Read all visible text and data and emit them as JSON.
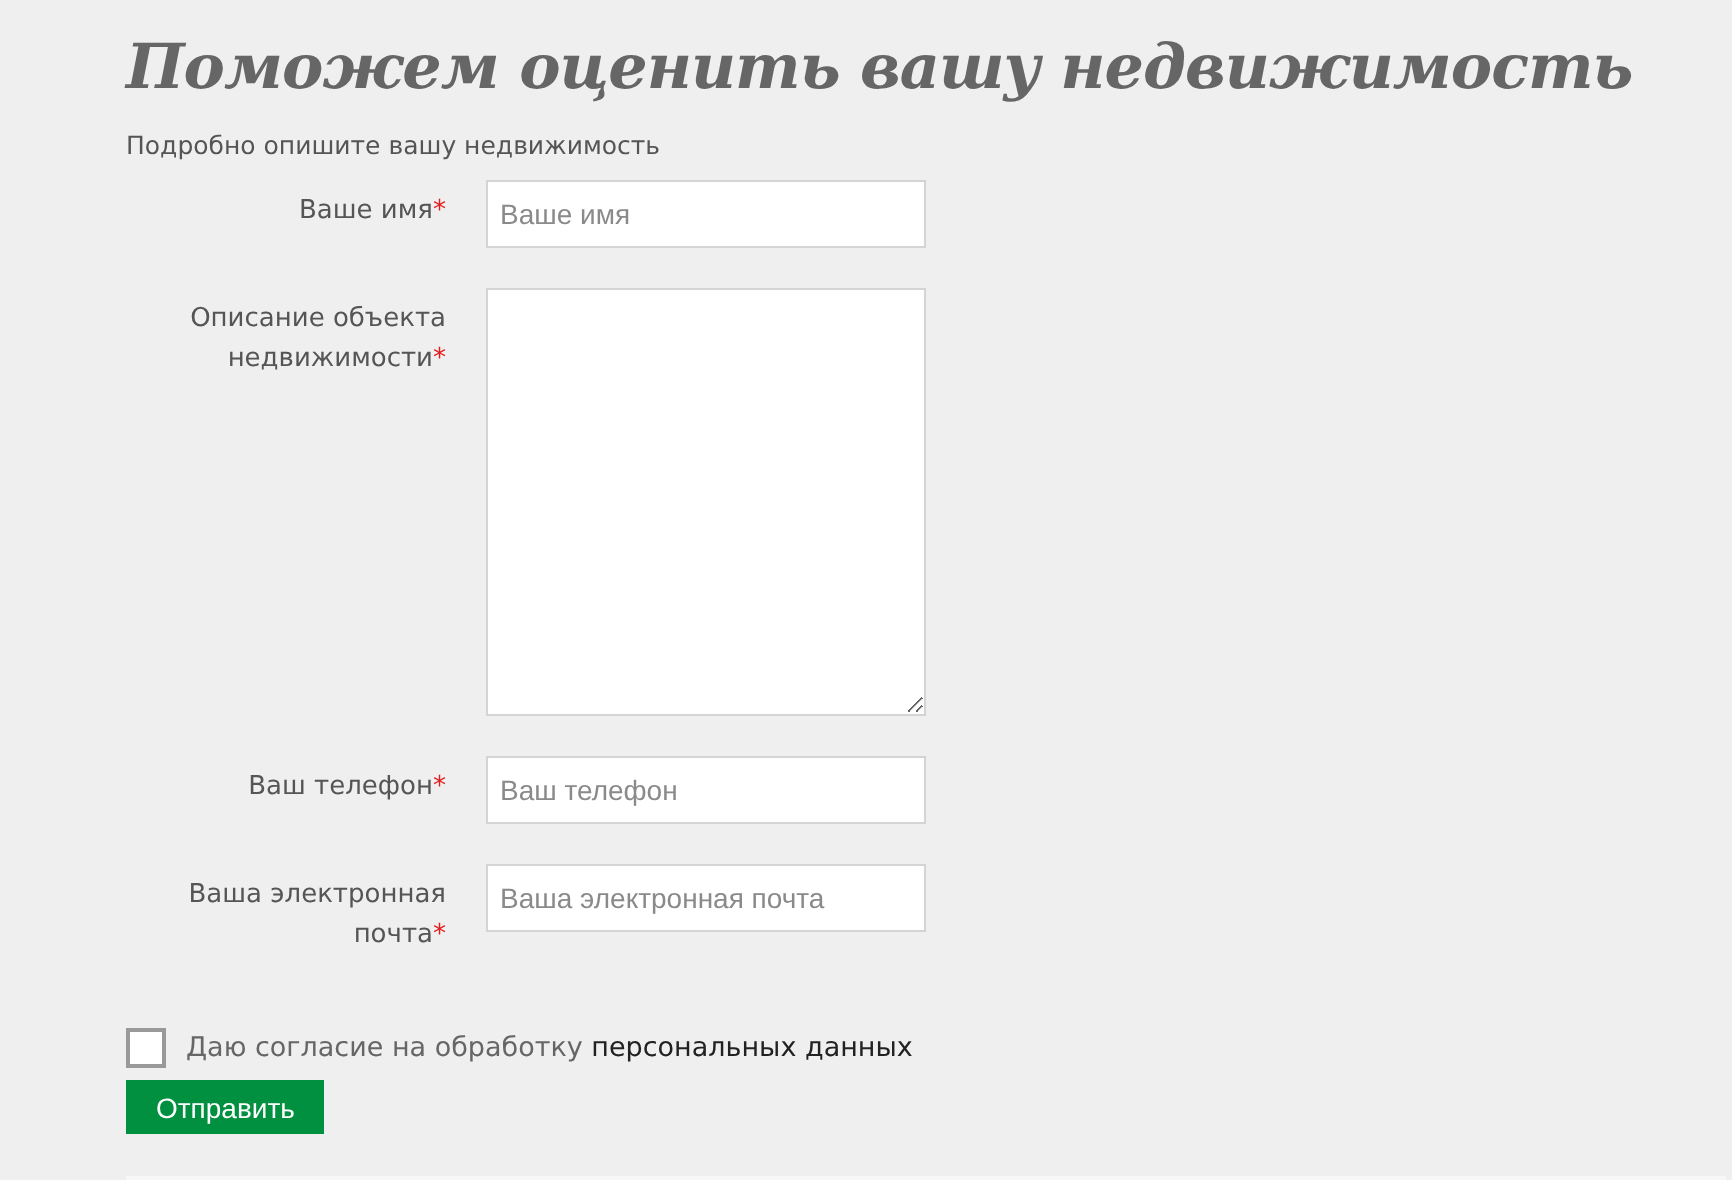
{
  "title": "Поможем оценить вашу недвижимость",
  "subtitle": "Подробно опишите вашу недвижимость",
  "fields": [
    {
      "kind": "input",
      "label": "Ваше имя",
      "required_mark": "*",
      "placeholder": "Ваше имя"
    },
    {
      "kind": "textarea",
      "label": "Описание объекта недвижимости",
      "required_mark": "*"
    },
    {
      "kind": "input",
      "label": "Ваш телефон",
      "required_mark": "*",
      "placeholder": "Ваш телефон"
    },
    {
      "kind": "input",
      "label": "Ваша электронная почта",
      "required_mark": "*",
      "placeholder": "Ваша электронная почта"
    }
  ],
  "consent": {
    "checked": false,
    "text": "Даю согласие на обработку",
    "link": "персональных данных"
  },
  "submit": "Отправить"
}
